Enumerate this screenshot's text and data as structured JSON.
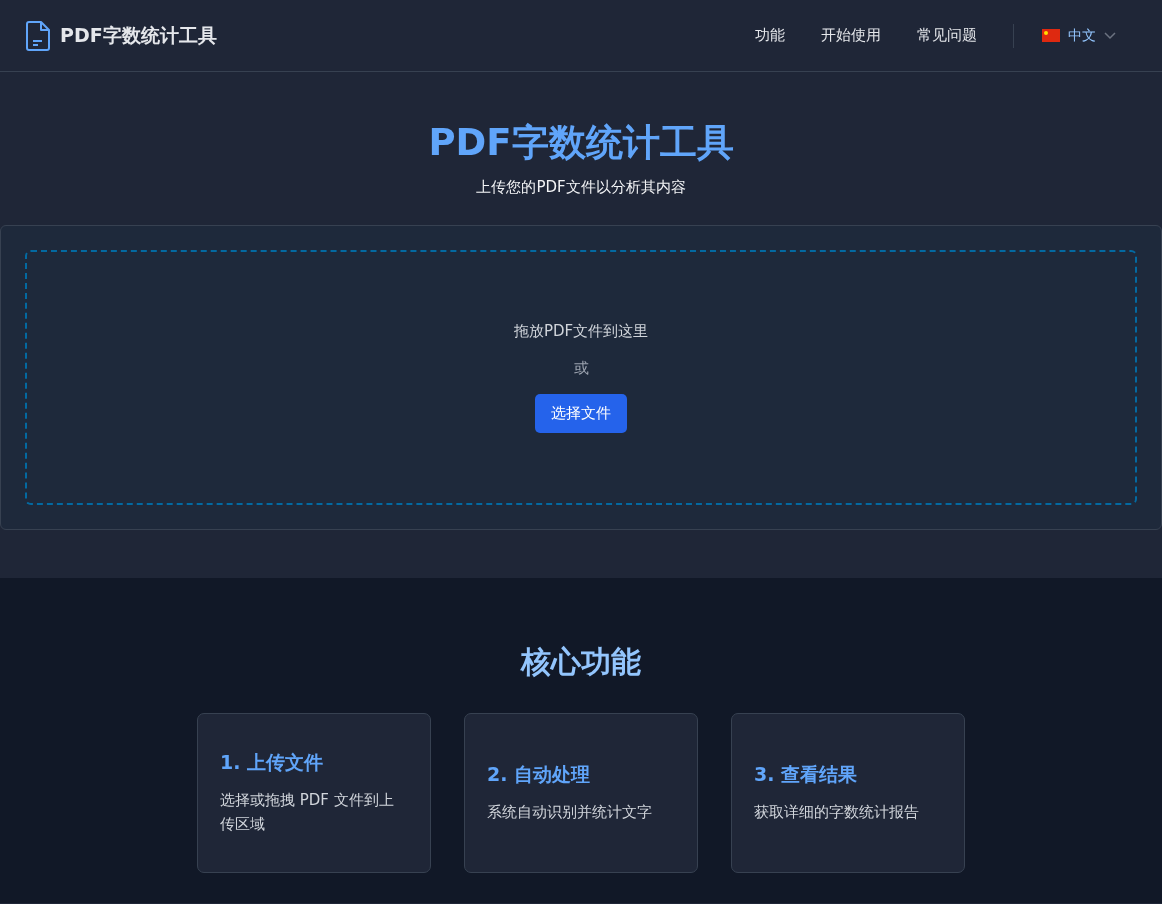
{
  "header": {
    "title": "PDF字数统计工具",
    "nav": [
      "功能",
      "开始使用",
      "常见问题"
    ],
    "language": "中文"
  },
  "hero": {
    "title": "PDF字数统计工具",
    "subtitle": "上传您的PDF文件以分析其内容"
  },
  "upload": {
    "prompt": "拖放PDF文件到这里",
    "or": "或",
    "button": "选择文件"
  },
  "features": {
    "title": "核心功能",
    "cards": [
      {
        "title": "1. 上传文件",
        "description": "选择或拖拽 PDF 文件到上传区域"
      },
      {
        "title": "2. 自动处理",
        "description": "系统自动识别并统计文字"
      },
      {
        "title": "3. 查看结果",
        "description": "获取详细的字数统计报告"
      }
    ]
  }
}
